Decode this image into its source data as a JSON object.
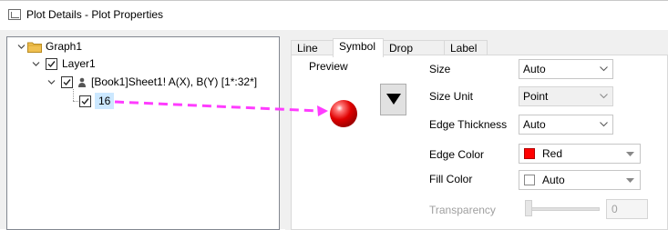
{
  "window": {
    "title": "Plot Details - Plot Properties"
  },
  "tree": {
    "graph": {
      "label": "Graph1"
    },
    "layer": {
      "label": "Layer1"
    },
    "dataset": {
      "label": "[Book1]Sheet1! A(X), B(Y) [1*:32*]"
    },
    "plot": {
      "label": "16"
    }
  },
  "tabs": [
    {
      "label": "Line",
      "active": false
    },
    {
      "label": "Symbol",
      "active": true
    },
    {
      "label": "Drop Lines",
      "active": false
    },
    {
      "label": "Label",
      "active": false
    }
  ],
  "preview": {
    "label": "Preview"
  },
  "fields": {
    "size": {
      "label": "Size",
      "value": "Auto"
    },
    "size_unit": {
      "label": "Size Unit",
      "value": "Point"
    },
    "edge_thickness": {
      "label": "Edge Thickness",
      "value": "Auto"
    },
    "edge_color": {
      "label": "Edge Color",
      "value": "Red",
      "swatch": "#ff0000"
    },
    "fill_color": {
      "label": "Fill Color",
      "value": "Auto",
      "swatch": "#ffffff"
    },
    "transparency": {
      "label": "Transparency",
      "value": "0"
    }
  },
  "colors": {
    "symbol_fill": "#e00000",
    "arrow_annotation": "#ff3cff",
    "selection": "#cce8ff"
  }
}
